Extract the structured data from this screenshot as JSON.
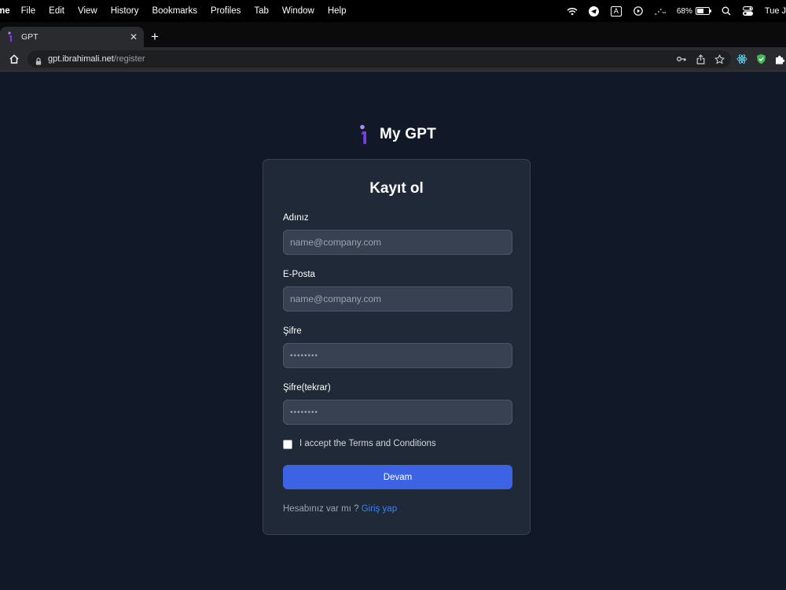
{
  "menubar": {
    "items": [
      "me",
      "File",
      "Edit",
      "View",
      "History",
      "Bookmarks",
      "Profiles",
      "Tab",
      "Window",
      "Help"
    ],
    "battery_percent": "68%",
    "battery_level": 0.68,
    "keyboard_input": "A",
    "date_text": "Tue J"
  },
  "browser": {
    "tab_title": "GPT",
    "tab_close": "✕",
    "new_tab": "+",
    "url_host": "gpt.ibrahimali.net",
    "url_path": "/register"
  },
  "page": {
    "brand_name": "My GPT",
    "form_title": "Kayıt ol",
    "fields": {
      "name_label": "Adınız",
      "name_placeholder": "name@company.com",
      "email_label": "E-Posta",
      "email_placeholder": "name@company.com",
      "password_label": "Şifre",
      "password_placeholder": "••••••••",
      "password_confirm_label": "Şifre(tekrar)",
      "password_confirm_placeholder": "••••••••"
    },
    "terms_label": "I accept the Terms and Conditions",
    "submit_label": "Devam",
    "have_account_text": "Hesabınız var mı ?",
    "signin_link": "Giriş yap"
  },
  "colors": {
    "page_bg": "#111827",
    "card_bg": "#1f2937",
    "input_bg": "#374151",
    "primary_button": "#3b63e3",
    "link": "#3b82f6",
    "logo_purple": "#7c3aed"
  },
  "icons": [
    "wifi-icon",
    "telegram-icon",
    "keyboard-input-icon",
    "play-circle-icon",
    "activity-icon",
    "battery-icon",
    "search-icon",
    "control-center-icon",
    "home-icon",
    "lock-icon",
    "key-icon",
    "share-icon",
    "star-icon",
    "react-devtools-icon",
    "shield-extension-icon",
    "extensions-puzzle-icon",
    "close-icon",
    "plus-icon"
  ]
}
